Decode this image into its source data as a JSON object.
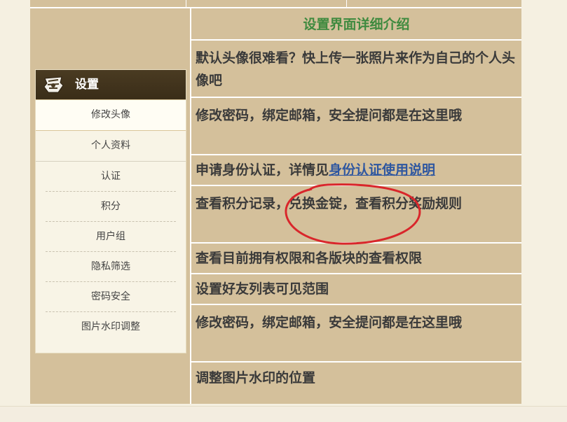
{
  "panel": {
    "title": "设置",
    "icon": "settings-badge-icon",
    "items": [
      {
        "label": "修改头像"
      },
      {
        "label": "个人资料"
      },
      {
        "label": "认证"
      },
      {
        "label": "积分"
      },
      {
        "label": "用户组"
      },
      {
        "label": "隐私筛选"
      },
      {
        "label": "密码安全"
      },
      {
        "label": "图片水印调整"
      }
    ]
  },
  "intro": {
    "header": "设置界面详细介绍",
    "rows": [
      {
        "text": "默认头像很难看？快上传一张照片来作为自己的个人头像吧"
      },
      {
        "text": "修改密码，绑定邮箱，安全提问都是在这里哦"
      },
      {
        "text_prefix": "申请身份认证，详情见",
        "link": "身份认证使用说明"
      },
      {
        "text": "查看积分记录，兑换金锭，查看积分奖励规则"
      },
      {
        "text": "查看目前拥有权限和各版块的查看权限"
      },
      {
        "text": "设置好友列表可见范围"
      },
      {
        "text": "修改密码，绑定邮箱，安全提问都是在这里哦"
      },
      {
        "text": "调整图片水印的位置"
      }
    ]
  },
  "colors": {
    "table_bg": "#d4c09b",
    "header_text": "#3f8a3f",
    "link": "#2f57a0",
    "annotation": "#d9262b"
  }
}
